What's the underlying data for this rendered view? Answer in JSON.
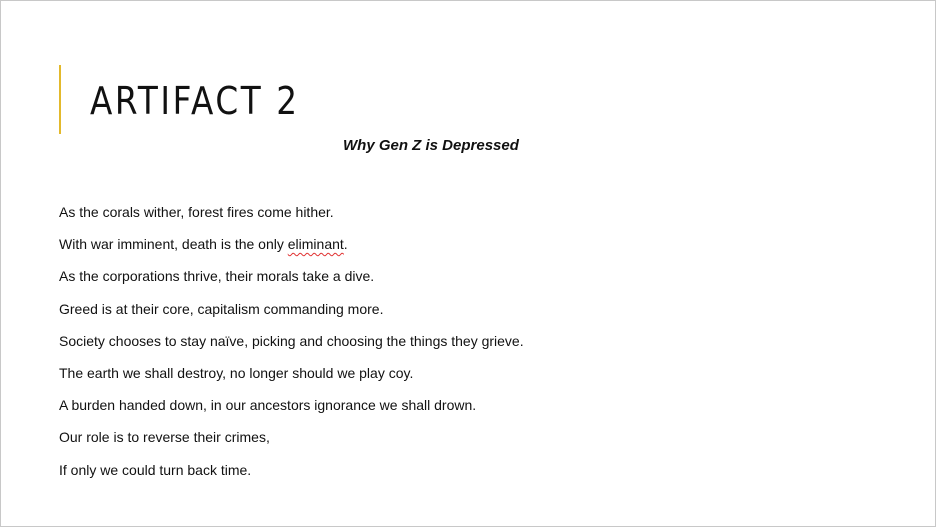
{
  "slide": {
    "title": "ARTIFACT 2",
    "subtitle": "Why Gen Z is Depressed",
    "accent_color": "#e3b92c",
    "lines": [
      "As the corals wither, forest fires come hither.",
      "With war imminent, death is the only ",
      "As the corporations thrive, their morals take a dive.",
      "Greed is at their core, capitalism commanding more.",
      "Society chooses to stay naïve, picking and choosing the things they grieve.",
      "The earth we shall destroy, no longer should we play coy.",
      "A burden handed down, in our ancestors ignorance we shall drown.",
      "Our role is to reverse their crimes,",
      "If only we could turn back time."
    ],
    "misspelled_word": "eliminant",
    "line2_end": "."
  }
}
